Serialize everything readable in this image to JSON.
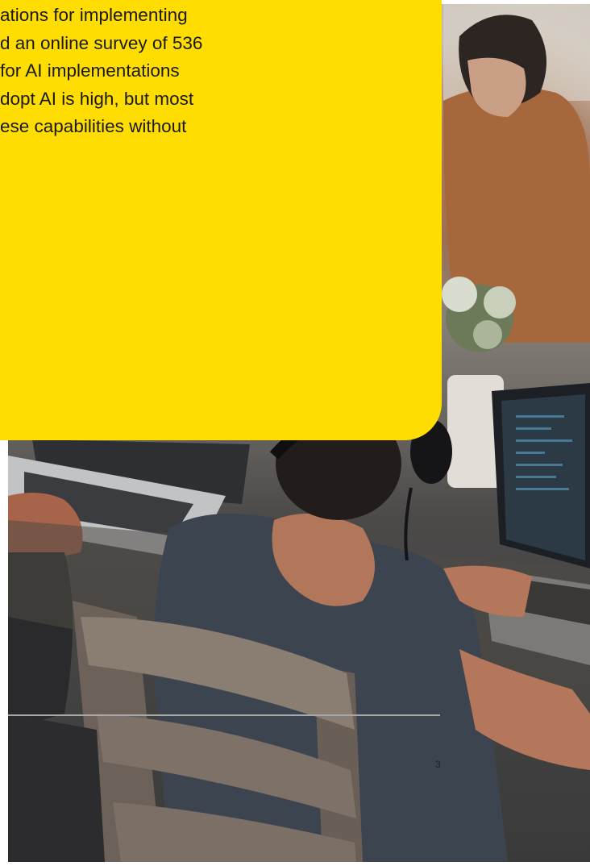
{
  "callout": {
    "lines": [
      "ations for implementing",
      "d an online survey of 536",
      "for AI implementations",
      "dopt AI is high, but most",
      "ese capabilities without"
    ],
    "background_color": "#ffdd00",
    "text_color": "#1a1a1a"
  },
  "photo": {
    "subject_icon": "office-photo-icon"
  },
  "footer": {
    "page_number": "3",
    "divider_color": "#a8a8a8"
  }
}
